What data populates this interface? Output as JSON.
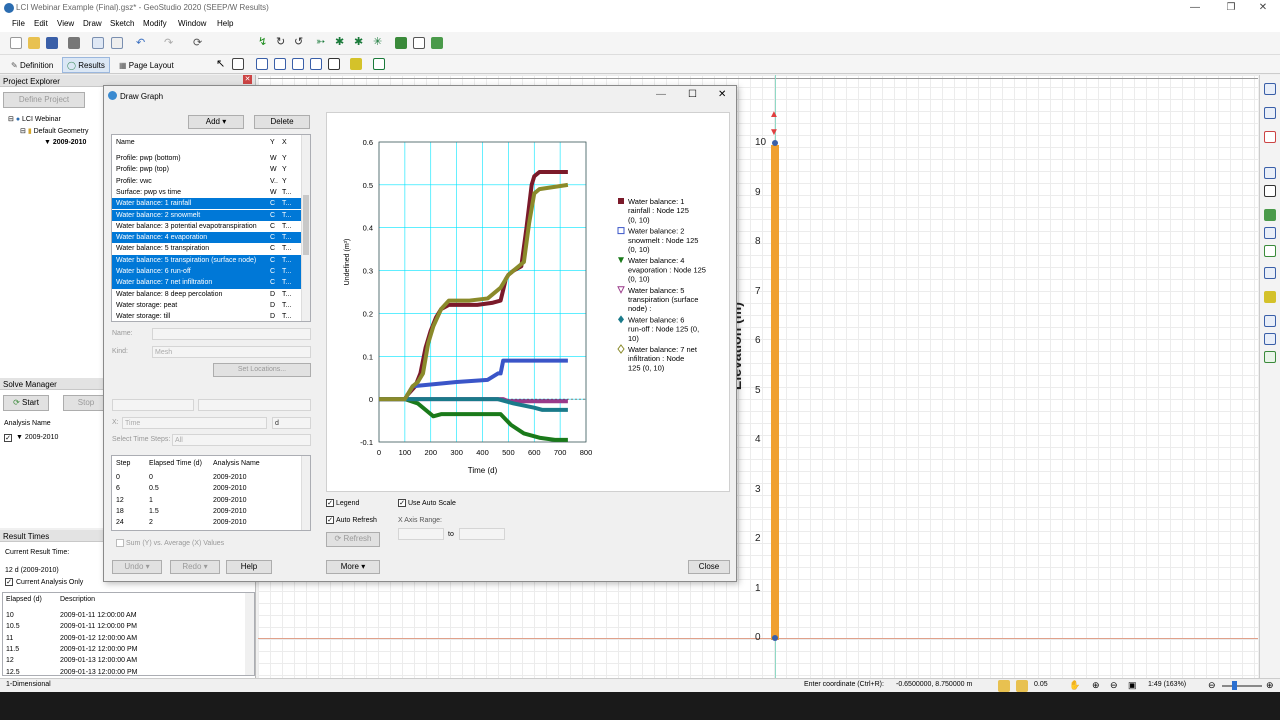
{
  "window": {
    "title": "LCI Webinar Example (Final).gsz* - GeoStudio 2020 (SEEP/W Results)"
  },
  "menu": [
    "File",
    "Edit",
    "View",
    "Draw",
    "Sketch",
    "Modify",
    "Window",
    "Help"
  ],
  "modes": {
    "definition": "Definition",
    "results": "Results",
    "page_layout": "Page Layout"
  },
  "project_explorer": {
    "title": "Project Explorer",
    "define_button": "Define Project",
    "tree": [
      "LCI Webinar",
      "Default Geometry",
      "2009-2010"
    ]
  },
  "solve_manager": {
    "title": "Solve Manager",
    "start": "Start",
    "stop": "Stop",
    "column": "Analysis Name",
    "analysis": "2009-2010"
  },
  "result_times": {
    "title": "Result Times",
    "current_label": "Current Result Time:",
    "current_value": "12 d (2009-2010)",
    "current_only": "Current Analysis Only",
    "col_elapsed": "Elapsed (d)",
    "col_description": "Description",
    "rows": [
      {
        "elapsed": "10",
        "desc": "2009-01-11 12:00:00 AM"
      },
      {
        "elapsed": "10.5",
        "desc": "2009-01-11 12:00:00 PM"
      },
      {
        "elapsed": "11",
        "desc": "2009-01-12 12:00:00 AM"
      },
      {
        "elapsed": "11.5",
        "desc": "2009-01-12 12:00:00 PM"
      },
      {
        "elapsed": "12",
        "desc": "2009-01-13 12:00:00 AM"
      },
      {
        "elapsed": "12.5",
        "desc": "2009-01-13 12:00:00 PM"
      }
    ]
  },
  "canvas": {
    "axis_label": "Elevation (m)",
    "y_ticks": [
      "10",
      "9",
      "8",
      "7",
      "6",
      "5",
      "4",
      "3",
      "2",
      "1",
      "0"
    ]
  },
  "dialog": {
    "title": "Draw Graph",
    "add": "Add",
    "delete": "Delete",
    "list_header": {
      "name": "Name",
      "y": "Y",
      "x": "X"
    },
    "items": [
      {
        "name": "Profile: pwp (bottom)",
        "y": "W",
        "x": "Y",
        "sel": false
      },
      {
        "name": "Profile: pwp (top)",
        "y": "W",
        "x": "Y",
        "sel": false
      },
      {
        "name": "Profile: vwc",
        "y": "V..",
        "x": "Y",
        "sel": false
      },
      {
        "name": "Surface: pwp vs time",
        "y": "W",
        "x": "T...",
        "sel": false
      },
      {
        "name": "Water balance: 1 rainfall",
        "y": "C",
        "x": "T...",
        "sel": true
      },
      {
        "name": "Water balance: 2 snowmelt",
        "y": "C",
        "x": "T...",
        "sel": true
      },
      {
        "name": "Water balance: 3 potential evapotranspiration",
        "y": "C",
        "x": "T...",
        "sel": false
      },
      {
        "name": "Water balance: 4 evaporation",
        "y": "C",
        "x": "T...",
        "sel": true
      },
      {
        "name": "Water balance: 5 transpiration",
        "y": "C",
        "x": "T...",
        "sel": false
      },
      {
        "name": "Water balance: 5 transpiration (surface node)",
        "y": "C",
        "x": "T...",
        "sel": true
      },
      {
        "name": "Water balance: 6 run-off",
        "y": "C",
        "x": "T...",
        "sel": true
      },
      {
        "name": "Water balance: 7 net infiltration",
        "y": "C",
        "x": "T...",
        "sel": true
      },
      {
        "name": "Water balance: 8 deep percolation",
        "y": "D",
        "x": "T...",
        "sel": false
      },
      {
        "name": "Water storage: peat",
        "y": "D",
        "x": "T...",
        "sel": false
      },
      {
        "name": "Water storage: till",
        "y": "D",
        "x": "T...",
        "sel": false
      }
    ],
    "name_label": "Name:",
    "kind_label": "Kind:",
    "kind_value": "Mesh",
    "set_locations": "Set Locations...",
    "x_label": "X:",
    "x_value": "Time",
    "x_unit": "d",
    "select_steps_label": "Select Time Steps:",
    "select_steps_value": "All",
    "steps_header": {
      "step": "Step",
      "elapsed": "Elapsed Time (d)",
      "analysis": "Analysis Name"
    },
    "steps": [
      {
        "step": "0",
        "elapsed": "0",
        "analysis": "2009-2010"
      },
      {
        "step": "6",
        "elapsed": "0.5",
        "analysis": "2009-2010"
      },
      {
        "step": "12",
        "elapsed": "1",
        "analysis": "2009-2010"
      },
      {
        "step": "18",
        "elapsed": "1.5",
        "analysis": "2009-2010"
      },
      {
        "step": "24",
        "elapsed": "2",
        "analysis": "2009-2010"
      }
    ],
    "sum_label": "Sum (Y) vs. Average (X) Values",
    "undo": "Undo",
    "redo": "Redo",
    "help": "Help",
    "more": "More",
    "close": "Close",
    "legend_label": "Legend",
    "auto_refresh": "Auto Refresh",
    "refresh": "Refresh",
    "use_auto_scale": "Use Auto Scale",
    "x_axis_range": "X Axis Range:",
    "to": "to"
  },
  "chart_data": {
    "type": "line",
    "xlabel": "Time (d)",
    "ylabel": "Undefined (m³)",
    "xlim": [
      0,
      800
    ],
    "ylim": [
      -0.1,
      0.6
    ],
    "x_ticks": [
      0,
      100,
      200,
      300,
      400,
      500,
      600,
      700,
      800
    ],
    "y_ticks": [
      -0.1,
      0,
      0.1,
      0.2,
      0.3,
      0.4,
      0.5,
      0.6
    ],
    "grid": true,
    "legend_position": "right",
    "series": [
      {
        "name": "Water balance: 1 rainfall : Node 125 (0, 10)",
        "color": "#7b1a2a",
        "marker": "square",
        "points": [
          [
            0,
            0
          ],
          [
            100,
            0
          ],
          [
            110,
            0.01
          ],
          [
            140,
            0.03
          ],
          [
            160,
            0.06
          ],
          [
            180,
            0.12
          ],
          [
            200,
            0.16
          ],
          [
            220,
            0.19
          ],
          [
            240,
            0.21
          ],
          [
            270,
            0.22
          ],
          [
            330,
            0.22
          ],
          [
            380,
            0.22
          ],
          [
            440,
            0.225
          ],
          [
            470,
            0.23
          ],
          [
            490,
            0.28
          ],
          [
            500,
            0.29
          ],
          [
            520,
            0.3
          ],
          [
            550,
            0.31
          ],
          [
            570,
            0.4
          ],
          [
            590,
            0.5
          ],
          [
            600,
            0.52
          ],
          [
            620,
            0.53
          ],
          [
            730,
            0.53
          ]
        ]
      },
      {
        "name": "Water balance: 2 snowmelt : Node 125 (0, 10)",
        "color": "#3a55c8",
        "marker": "square-open",
        "points": [
          [
            0,
            0
          ],
          [
            100,
            0
          ],
          [
            110,
            0.01
          ],
          [
            130,
            0.03
          ],
          [
            300,
            0.04
          ],
          [
            420,
            0.045
          ],
          [
            460,
            0.06
          ],
          [
            470,
            0.06
          ],
          [
            480,
            0.09
          ],
          [
            730,
            0.09
          ]
        ]
      },
      {
        "name": "Water balance: 4 evaporation : Node 125 (0, 10)",
        "color": "#1a7a1a",
        "marker": "triangle-down",
        "points": [
          [
            0,
            0
          ],
          [
            100,
            0
          ],
          [
            150,
            -0.01
          ],
          [
            190,
            -0.03
          ],
          [
            210,
            -0.04
          ],
          [
            240,
            -0.035
          ],
          [
            360,
            -0.035
          ],
          [
            470,
            -0.035
          ],
          [
            510,
            -0.06
          ],
          [
            560,
            -0.08
          ],
          [
            620,
            -0.09
          ],
          [
            680,
            -0.095
          ],
          [
            730,
            -0.095
          ]
        ]
      },
      {
        "name": "Water balance: 5 transpiration (surface node) :",
        "color": "#9a3a8a",
        "marker": "triangle-open",
        "points": [
          [
            0,
            0
          ],
          [
            480,
            0
          ],
          [
            500,
            -0.005
          ],
          [
            730,
            -0.005
          ]
        ]
      },
      {
        "name": "Water balance: 6 run-off : Node 125 (0, 10)",
        "color": "#1a7a8a",
        "marker": "diamond",
        "points": [
          [
            0,
            0
          ],
          [
            460,
            0
          ],
          [
            520,
            -0.01
          ],
          [
            600,
            -0.02
          ],
          [
            630,
            -0.025
          ],
          [
            730,
            -0.025
          ]
        ]
      },
      {
        "name": "Water balance: 7 net infiltration : Node 125 (0, 10)",
        "color": "#8a8a2a",
        "marker": "diamond-open",
        "points": [
          [
            0,
            0
          ],
          [
            100,
            0
          ],
          [
            130,
            0.03
          ],
          [
            150,
            0.04
          ],
          [
            170,
            0.06
          ],
          [
            190,
            0.13
          ],
          [
            210,
            0.17
          ],
          [
            240,
            0.21
          ],
          [
            270,
            0.23
          ],
          [
            350,
            0.23
          ],
          [
            420,
            0.235
          ],
          [
            470,
            0.26
          ],
          [
            500,
            0.29
          ],
          [
            520,
            0.3
          ],
          [
            560,
            0.32
          ],
          [
            580,
            0.41
          ],
          [
            600,
            0.48
          ],
          [
            620,
            0.49
          ],
          [
            730,
            0.5
          ]
        ]
      }
    ]
  },
  "statusbar": {
    "mode": "1-Dimensional",
    "coord_label": "Enter coordinate (Ctrl+R):",
    "coord_value": "-0.6500000, 8.750000 m",
    "snap": "0.05",
    "scale": "1:49 (163%)"
  }
}
